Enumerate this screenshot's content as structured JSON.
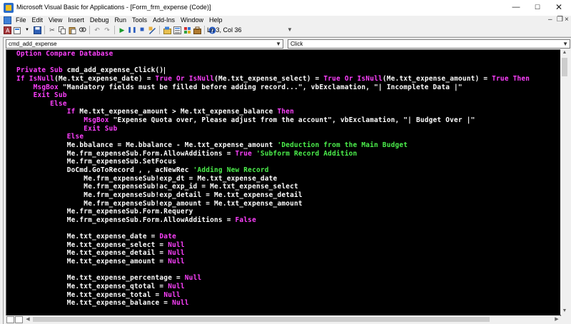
{
  "window": {
    "title": "Microsoft Visual Basic for Applications - [Form_frm_expense (Code)]"
  },
  "menu": {
    "items": [
      "File",
      "Edit",
      "View",
      "Insert",
      "Debug",
      "Run",
      "Tools",
      "Add-Ins",
      "Window",
      "Help"
    ]
  },
  "toolbar": {
    "position": "Ln 3, Col 36",
    "icons": [
      "access-icon",
      "insert-module-icon",
      "save-icon",
      "cut-icon",
      "copy-icon",
      "paste-icon",
      "find-icon",
      "undo-icon",
      "redo-icon",
      "run-icon",
      "break-icon",
      "reset-icon",
      "design-mode-icon",
      "project-explorer-icon",
      "properties-icon",
      "object-browser-icon",
      "toolbox-icon",
      "help-icon"
    ]
  },
  "code_window": {
    "object_combo": "cmd_add_expense",
    "procedure_combo": "Click",
    "lines": [
      [
        {
          "t": "Option Compare Database",
          "c": "kw"
        }
      ],
      [
        {
          "t": "",
          "c": "tx"
        }
      ],
      [
        {
          "t": "Private Sub",
          "c": "kw"
        },
        {
          "t": " cmd_add_expense_Click()",
          "c": "tx"
        },
        {
          "t": "",
          "c": "caret"
        }
      ],
      [
        {
          "t": "If",
          "c": "kw"
        },
        {
          "t": " ",
          "c": "tx"
        },
        {
          "t": "IsNull",
          "c": "kw"
        },
        {
          "t": "(Me.txt_expense_date) = ",
          "c": "tx"
        },
        {
          "t": "True Or",
          "c": "kw"
        },
        {
          "t": " ",
          "c": "tx"
        },
        {
          "t": "IsNull",
          "c": "kw"
        },
        {
          "t": "(Me.txt_expense_select) = ",
          "c": "tx"
        },
        {
          "t": "True Or",
          "c": "kw"
        },
        {
          "t": " ",
          "c": "tx"
        },
        {
          "t": "IsNull",
          "c": "kw"
        },
        {
          "t": "(Me.txt_expense_amount) = ",
          "c": "tx"
        },
        {
          "t": "True Then",
          "c": "kw"
        }
      ],
      [
        {
          "t": "    ",
          "c": "tx"
        },
        {
          "t": "MsgBox",
          "c": "kw"
        },
        {
          "t": " \"Mandatory fields must be filled before adding record...\", vbExclamation, \"| Incomplete Data |\"",
          "c": "tx"
        }
      ],
      [
        {
          "t": "    Exit Sub",
          "c": "kw"
        }
      ],
      [
        {
          "t": "        Else",
          "c": "kw"
        }
      ],
      [
        {
          "t": "            If",
          "c": "kw"
        },
        {
          "t": " Me.txt_expense_amount > Me.txt_expense_balance ",
          "c": "tx"
        },
        {
          "t": "Then",
          "c": "kw"
        }
      ],
      [
        {
          "t": "                ",
          "c": "tx"
        },
        {
          "t": "MsgBox",
          "c": "kw"
        },
        {
          "t": " \"Expense Quota over, Please adjust from the account\", vbExclamation, \"| Budget Over |\"",
          "c": "tx"
        }
      ],
      [
        {
          "t": "                Exit Sub",
          "c": "kw"
        }
      ],
      [
        {
          "t": "            Else",
          "c": "kw"
        }
      ],
      [
        {
          "t": "            Me.bbalance = Me.bbalance - Me.txt_expense_amount ",
          "c": "tx"
        },
        {
          "t": "'Deduction from the Main Budget",
          "c": "cm"
        }
      ],
      [
        {
          "t": "            Me.frm_expenseSub.Form.AllowAdditions = ",
          "c": "tx"
        },
        {
          "t": "True",
          "c": "kw"
        },
        {
          "t": " ",
          "c": "tx"
        },
        {
          "t": "'Subform Record Addition",
          "c": "cm"
        }
      ],
      [
        {
          "t": "            Me.frm_expenseSub.SetFocus",
          "c": "tx"
        }
      ],
      [
        {
          "t": "            DoCmd.GoToRecord , , acNewRec ",
          "c": "tx"
        },
        {
          "t": "'Adding New Record",
          "c": "cm"
        }
      ],
      [
        {
          "t": "                Me.frm_expenseSub!exp_dt = Me.txt_expense_date",
          "c": "tx"
        }
      ],
      [
        {
          "t": "                Me.frm_expenseSub!ac_exp_id = Me.txt_expense_select",
          "c": "tx"
        }
      ],
      [
        {
          "t": "                Me.frm_expenseSub!exp_detail = Me.txt_expense_detail",
          "c": "tx"
        }
      ],
      [
        {
          "t": "                Me.frm_expenseSub!exp_amount = Me.txt_expense_amount",
          "c": "tx"
        }
      ],
      [
        {
          "t": "            Me.frm_expenseSub.Form.Requery",
          "c": "tx"
        }
      ],
      [
        {
          "t": "            Me.frm_expenseSub.Form.AllowAdditions = ",
          "c": "tx"
        },
        {
          "t": "False",
          "c": "kw"
        }
      ],
      [
        {
          "t": "",
          "c": "tx"
        }
      ],
      [
        {
          "t": "            Me.txt_expense_date = ",
          "c": "tx"
        },
        {
          "t": "Date",
          "c": "kw"
        }
      ],
      [
        {
          "t": "            Me.txt_expense_select = ",
          "c": "tx"
        },
        {
          "t": "Null",
          "c": "kw"
        }
      ],
      [
        {
          "t": "            Me.txt_expense_detail = ",
          "c": "tx"
        },
        {
          "t": "Null",
          "c": "kw"
        }
      ],
      [
        {
          "t": "            Me.txt_expense_amount = ",
          "c": "tx"
        },
        {
          "t": "Null",
          "c": "kw"
        }
      ],
      [
        {
          "t": "",
          "c": "tx"
        }
      ],
      [
        {
          "t": "            Me.txt_expense_percentage = ",
          "c": "tx"
        },
        {
          "t": "Null",
          "c": "kw"
        }
      ],
      [
        {
          "t": "            Me.txt_expense_qtotal = ",
          "c": "tx"
        },
        {
          "t": "Null",
          "c": "kw"
        }
      ],
      [
        {
          "t": "            Me.txt_expense_total = ",
          "c": "tx"
        },
        {
          "t": "Null",
          "c": "kw"
        }
      ],
      [
        {
          "t": "            Me.txt_expense_balance = ",
          "c": "tx"
        },
        {
          "t": "Null",
          "c": "kw"
        }
      ]
    ]
  },
  "colors": {
    "editor_background": "#000000",
    "code_text": "#ffffff",
    "keyword": "#ff40ff",
    "comment": "#4cf04c"
  }
}
